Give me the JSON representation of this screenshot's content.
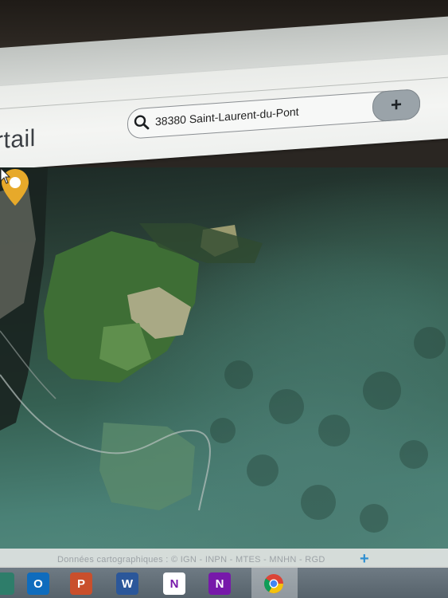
{
  "header": {
    "site_title": "rtail",
    "search": {
      "value": "38380 Saint-Laurent-du-Pont",
      "add_label": "+"
    }
  },
  "map": {
    "marker_color": "#e7a92a",
    "attribution": "Données cartographiques : © IGN - INPN - MTES - MNHN - RGD",
    "zoom_in_label": "+"
  },
  "taskbar": {
    "items": [
      {
        "name": "app-partial",
        "icon": "app-icon"
      },
      {
        "name": "outlook",
        "icon": "outlook-icon",
        "glyph": "O"
      },
      {
        "name": "powerpoint",
        "icon": "powerpoint-icon",
        "glyph": "P"
      },
      {
        "name": "word",
        "icon": "word-icon",
        "glyph": "W"
      },
      {
        "name": "onenote-2016",
        "icon": "onenote-icon",
        "glyph": "N"
      },
      {
        "name": "onenote",
        "icon": "onenote-icon",
        "glyph": "N"
      },
      {
        "name": "chrome",
        "icon": "chrome-icon"
      }
    ]
  },
  "colors": {
    "accent_blue": "#2f8fd1",
    "marker": "#e7a92a"
  }
}
